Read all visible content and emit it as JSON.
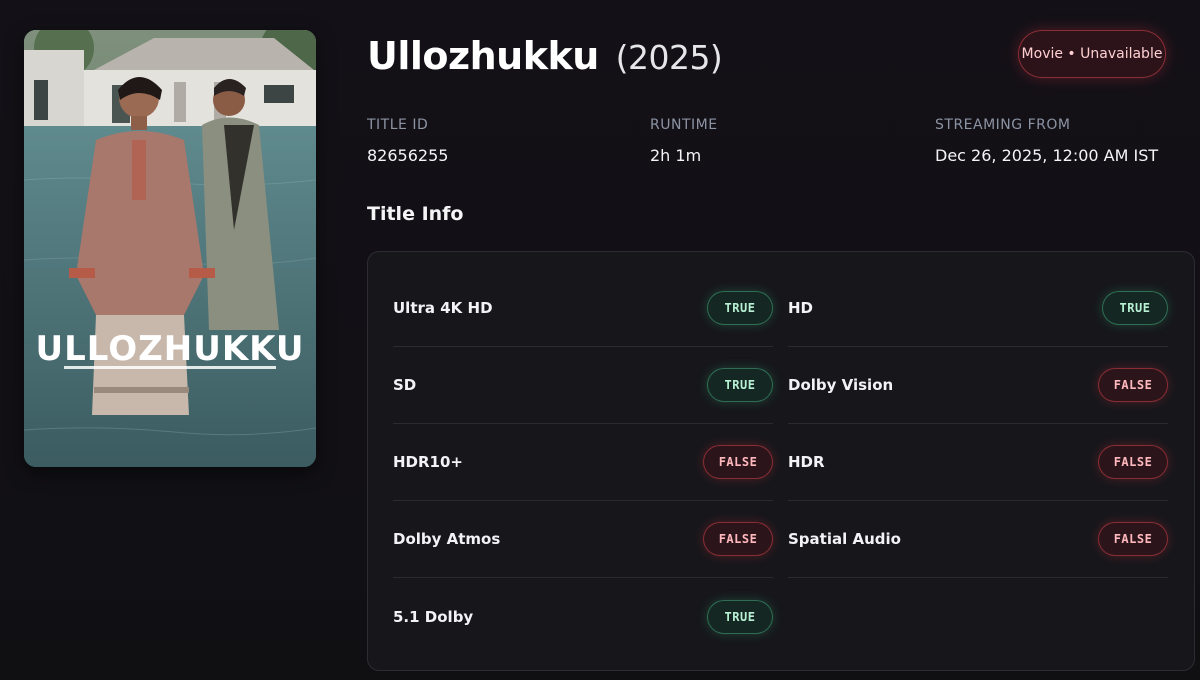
{
  "poster": {
    "title_text": "ULLOZHUKKU"
  },
  "header": {
    "title": "Ullozhukku",
    "year": "(2025)",
    "status_badge": "Movie • Unavailable"
  },
  "meta": [
    {
      "label": "TITLE ID",
      "value": "82656255"
    },
    {
      "label": "RUNTIME",
      "value": "2h 1m"
    },
    {
      "label": "STREAMING FROM",
      "value": "Dec 26, 2025, 12:00 AM IST"
    }
  ],
  "section_title": "Title Info",
  "title_info": [
    {
      "label": "Ultra 4K HD",
      "value": "TRUE"
    },
    {
      "label": "HD",
      "value": "TRUE"
    },
    {
      "label": "SD",
      "value": "TRUE"
    },
    {
      "label": "Dolby Vision",
      "value": "FALSE"
    },
    {
      "label": "HDR10+",
      "value": "FALSE"
    },
    {
      "label": "HDR",
      "value": "FALSE"
    },
    {
      "label": "Dolby Atmos",
      "value": "FALSE"
    },
    {
      "label": "Spatial Audio",
      "value": "FALSE"
    },
    {
      "label": "5.1 Dolby",
      "value": "TRUE"
    }
  ],
  "colors": {
    "true_accent": "#b7f0d3",
    "false_accent": "#ffb9be",
    "background": "#131117"
  }
}
